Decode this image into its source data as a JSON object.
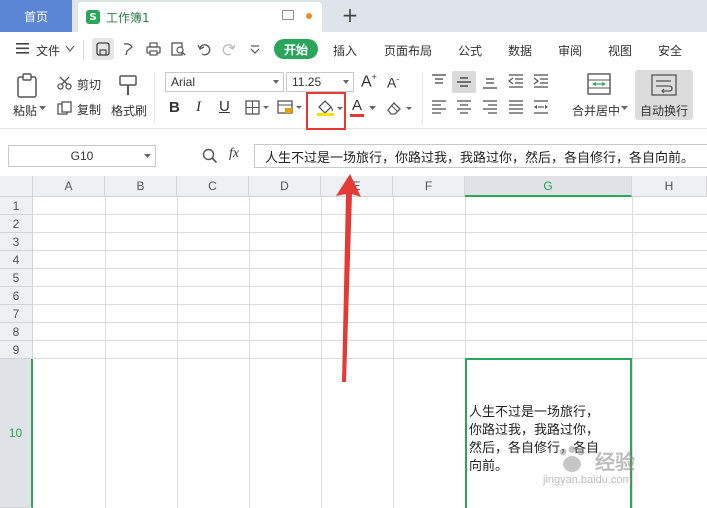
{
  "tabs": {
    "home": "首页",
    "workbook": "工作簿1",
    "add": "+"
  },
  "menu": {
    "file": "文件",
    "items": [
      "开始",
      "插入",
      "页面布局",
      "公式",
      "数据",
      "审阅",
      "视图",
      "安全"
    ]
  },
  "ribbon": {
    "paste": "粘贴",
    "cut": "剪切",
    "copy": "复制",
    "format_painter": "格式刷",
    "font_name": "Arial",
    "font_size": "11.25",
    "merge_center": "合并居中",
    "wrap_text": "自动换行",
    "bold": "B",
    "italic": "I",
    "underline": "U",
    "font_color_glyph": "A"
  },
  "formula_bar": {
    "name_box": "G10",
    "fx": "fx",
    "content": "人生不过是一场旅行，你路过我，我路过你，然后，各自修行，各自向前。"
  },
  "columns": [
    "A",
    "B",
    "C",
    "D",
    "E",
    "F",
    "G",
    "H"
  ],
  "rows": [
    "1",
    "2",
    "3",
    "4",
    "5",
    "6",
    "7",
    "8",
    "9",
    "10"
  ],
  "selected_cell": {
    "ref": "G10",
    "lines": [
      "人生不过是一场旅行，",
      "你路过我，我路过你，",
      "然后，各自修行，各自",
      "向前。"
    ]
  },
  "watermark": {
    "brand": "经验",
    "url": "jingyan.baidu.com"
  },
  "colors": {
    "accent_green": "#2aa65c",
    "highlight_red": "#e53935",
    "fill_yellow": "#f6e400"
  }
}
